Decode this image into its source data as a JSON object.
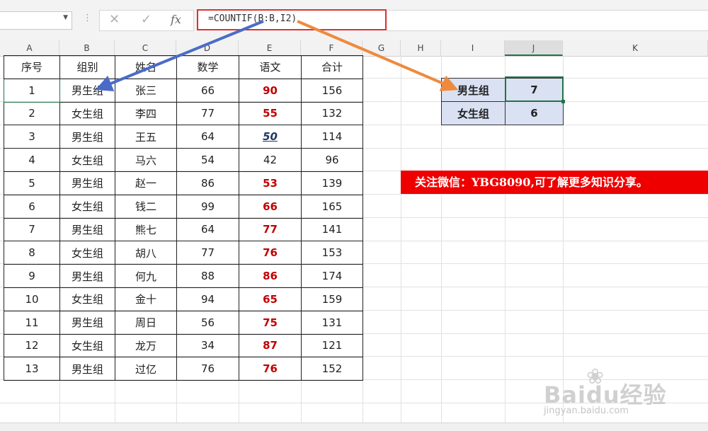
{
  "formula_bar": {
    "formula": "=COUNTIF(B:B,I2)",
    "cancel_glyph": "✕",
    "confirm_glyph": "✓",
    "fx_label": "fx"
  },
  "columns": [
    "A",
    "B",
    "C",
    "D",
    "E",
    "F",
    "G",
    "H",
    "I",
    "J",
    "K"
  ],
  "table": {
    "headers": [
      "序号",
      "组别",
      "姓名",
      "数学",
      "语文",
      "合计"
    ],
    "rows": [
      [
        "1",
        "男生组",
        "张三",
        "66",
        "90",
        "156"
      ],
      [
        "2",
        "女生组",
        "李四",
        "77",
        "55",
        "132"
      ],
      [
        "3",
        "男生组",
        "王五",
        "64",
        "50",
        "114"
      ],
      [
        "4",
        "女生组",
        "马六",
        "54",
        "42",
        "96"
      ],
      [
        "5",
        "男生组",
        "赵一",
        "86",
        "53",
        "139"
      ],
      [
        "6",
        "女生组",
        "钱二",
        "99",
        "66",
        "165"
      ],
      [
        "7",
        "男生组",
        "熊七",
        "64",
        "77",
        "141"
      ],
      [
        "8",
        "女生组",
        "胡八",
        "77",
        "76",
        "153"
      ],
      [
        "9",
        "男生组",
        "何九",
        "88",
        "86",
        "174"
      ],
      [
        "10",
        "女生组",
        "金十",
        "94",
        "65",
        "159"
      ],
      [
        "11",
        "男生组",
        "周日",
        "56",
        "75",
        "131"
      ],
      [
        "12",
        "女生组",
        "龙万",
        "34",
        "87",
        "121"
      ],
      [
        "13",
        "男生组",
        "过亿",
        "76",
        "76",
        "152"
      ]
    ]
  },
  "lookup": {
    "rows": [
      [
        "男生组",
        "7"
      ],
      [
        "女生组",
        "6"
      ]
    ]
  },
  "banner": "关注微信：YBG8090,可了解更多知识分享。",
  "watermark": {
    "brand": "Baidu经验",
    "url": "jingyan.baidu.com"
  },
  "colors": {
    "accent_green": "#217346",
    "banner_red": "#ef0000",
    "value_red": "#c00000",
    "arrow_blue": "#4a6cc8",
    "arrow_orange": "#ee8a3e",
    "lookup_fill": "#d9e1f2"
  },
  "icons": {
    "cancel": "close-icon",
    "confirm": "check-icon",
    "function": "fx-icon",
    "namebox_dropdown": "chevron-down-icon"
  }
}
